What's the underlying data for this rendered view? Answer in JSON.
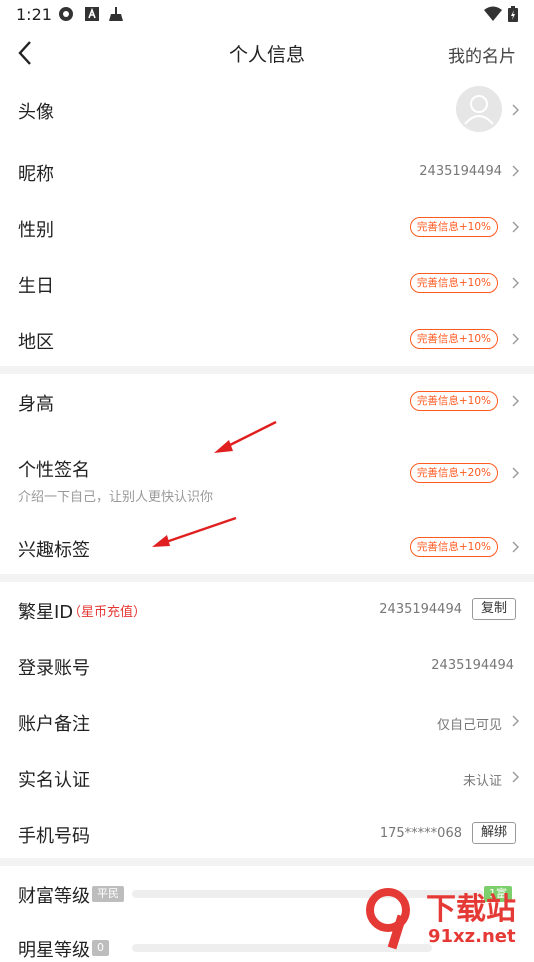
{
  "status": {
    "time": "1:21"
  },
  "header": {
    "title": "个人信息",
    "right_link": "我的名片"
  },
  "rows": {
    "avatar": {
      "label": "头像"
    },
    "nickname": {
      "label": "昵称",
      "value": "2435194494"
    },
    "gender": {
      "label": "性别",
      "badge": "完善信息+10%"
    },
    "birthday": {
      "label": "生日",
      "badge": "完善信息+10%"
    },
    "region": {
      "label": "地区",
      "badge": "完善信息+10%"
    },
    "height": {
      "label": "身高",
      "badge": "完善信息+10%"
    },
    "signature": {
      "label": "个性签名",
      "badge": "完善信息+20%",
      "placeholder": "介绍一下自己，让别人更快认识你"
    },
    "interests": {
      "label": "兴趣标签",
      "badge": "完善信息+10%"
    },
    "fanxing_id": {
      "label": "繁星ID",
      "recharge": "（星币充值）",
      "value": "2435194494",
      "button": "复制"
    },
    "login_account": {
      "label": "登录账号",
      "value": "2435194494"
    },
    "account_note": {
      "label": "账户备注",
      "value": "仅自己可见"
    },
    "real_name": {
      "label": "实名认证",
      "value": "未认证"
    },
    "phone": {
      "label": "手机号码",
      "value": "175*****068",
      "button": "解绑"
    },
    "wealth_level": {
      "label": "财富等级",
      "tag": "平民",
      "next": "1富"
    },
    "star_level": {
      "label": "明星等级",
      "tag": "0"
    }
  },
  "colors": {
    "accent": "#ff5a1f",
    "red": "#e53935",
    "divider": "#f3f3f3"
  },
  "watermark": {
    "text_top": "下载站",
    "text_bottom": "91xz.net"
  }
}
